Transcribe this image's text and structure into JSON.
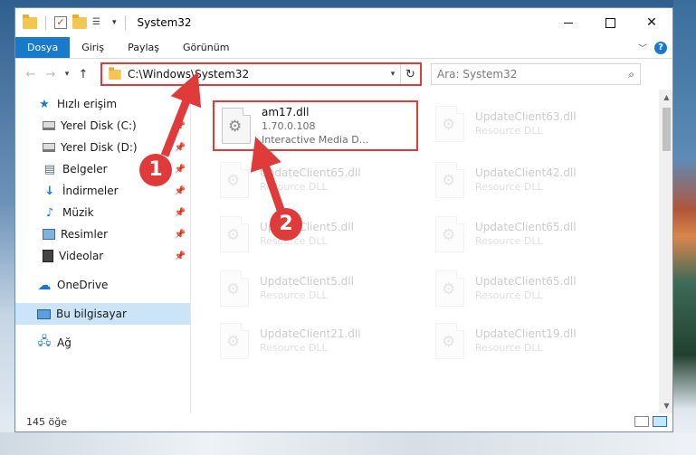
{
  "window": {
    "title": "System32",
    "quick_access_down": "▾"
  },
  "ribbon": {
    "tabs": [
      {
        "label": "Dosya"
      },
      {
        "label": "Giriş"
      },
      {
        "label": "Paylaş"
      },
      {
        "label": "Görünüm"
      }
    ],
    "help_label": "?"
  },
  "navbar": {
    "back": "←",
    "forward": "→",
    "recent": "▾",
    "up": "↑",
    "address": "C:\\Windows\\System32",
    "refresh": "↻",
    "search_placeholder": "Ara: System32"
  },
  "sidebar": {
    "items": [
      {
        "label": "Hızlı erişim",
        "icon": "star-icon"
      },
      {
        "label": "Yerel Disk (C:)",
        "icon": "drive-icon",
        "pinned": true
      },
      {
        "label": "Yerel Disk (D:)",
        "icon": "drive-icon",
        "pinned": true
      },
      {
        "label": "Belgeler",
        "icon": "documents-icon",
        "pinned": true
      },
      {
        "label": "İndirmeler",
        "icon": "downloads-icon",
        "pinned": true
      },
      {
        "label": "Müzik",
        "icon": "music-icon",
        "pinned": true
      },
      {
        "label": "Resimler",
        "icon": "pictures-icon",
        "pinned": true
      },
      {
        "label": "Videolar",
        "icon": "videos-icon",
        "pinned": true
      },
      {
        "label": "OneDrive",
        "icon": "onedrive-icon"
      },
      {
        "label": "Bu bilgisayar",
        "icon": "this-pc-icon",
        "selected": true
      },
      {
        "label": "Ağ",
        "icon": "network-icon"
      }
    ]
  },
  "files": {
    "highlighted": {
      "name": "am17.dll",
      "version": "1.70.0.108",
      "description": "Interactive Media D..."
    },
    "faded_left": [
      {
        "name": "UpdateClient65.dll",
        "sub": "Resource DLL"
      },
      {
        "name": "UpdateClient5.dll",
        "sub": "Resource DLL"
      },
      {
        "name": "UpdateClient5.dll",
        "sub": "Resource DLL"
      },
      {
        "name": "UpdateClient21.dll",
        "sub": "Resource DLL"
      }
    ],
    "faded_right": [
      {
        "name": "UpdateClient63.dll",
        "sub": "Resource DLL"
      },
      {
        "name": "UpdateClient42.dll",
        "sub": "Resource DLL"
      },
      {
        "name": "UpdateClient65.dll",
        "sub": "Resource DLL"
      },
      {
        "name": "UpdateClient65.dll",
        "sub": "Resource DLL"
      },
      {
        "name": "UpdateClient19.dll",
        "sub": "Resource DLL"
      }
    ]
  },
  "status": {
    "count": "145 öğe"
  },
  "annotations": {
    "step1": "1",
    "step2": "2",
    "color": "#e03b3b"
  }
}
